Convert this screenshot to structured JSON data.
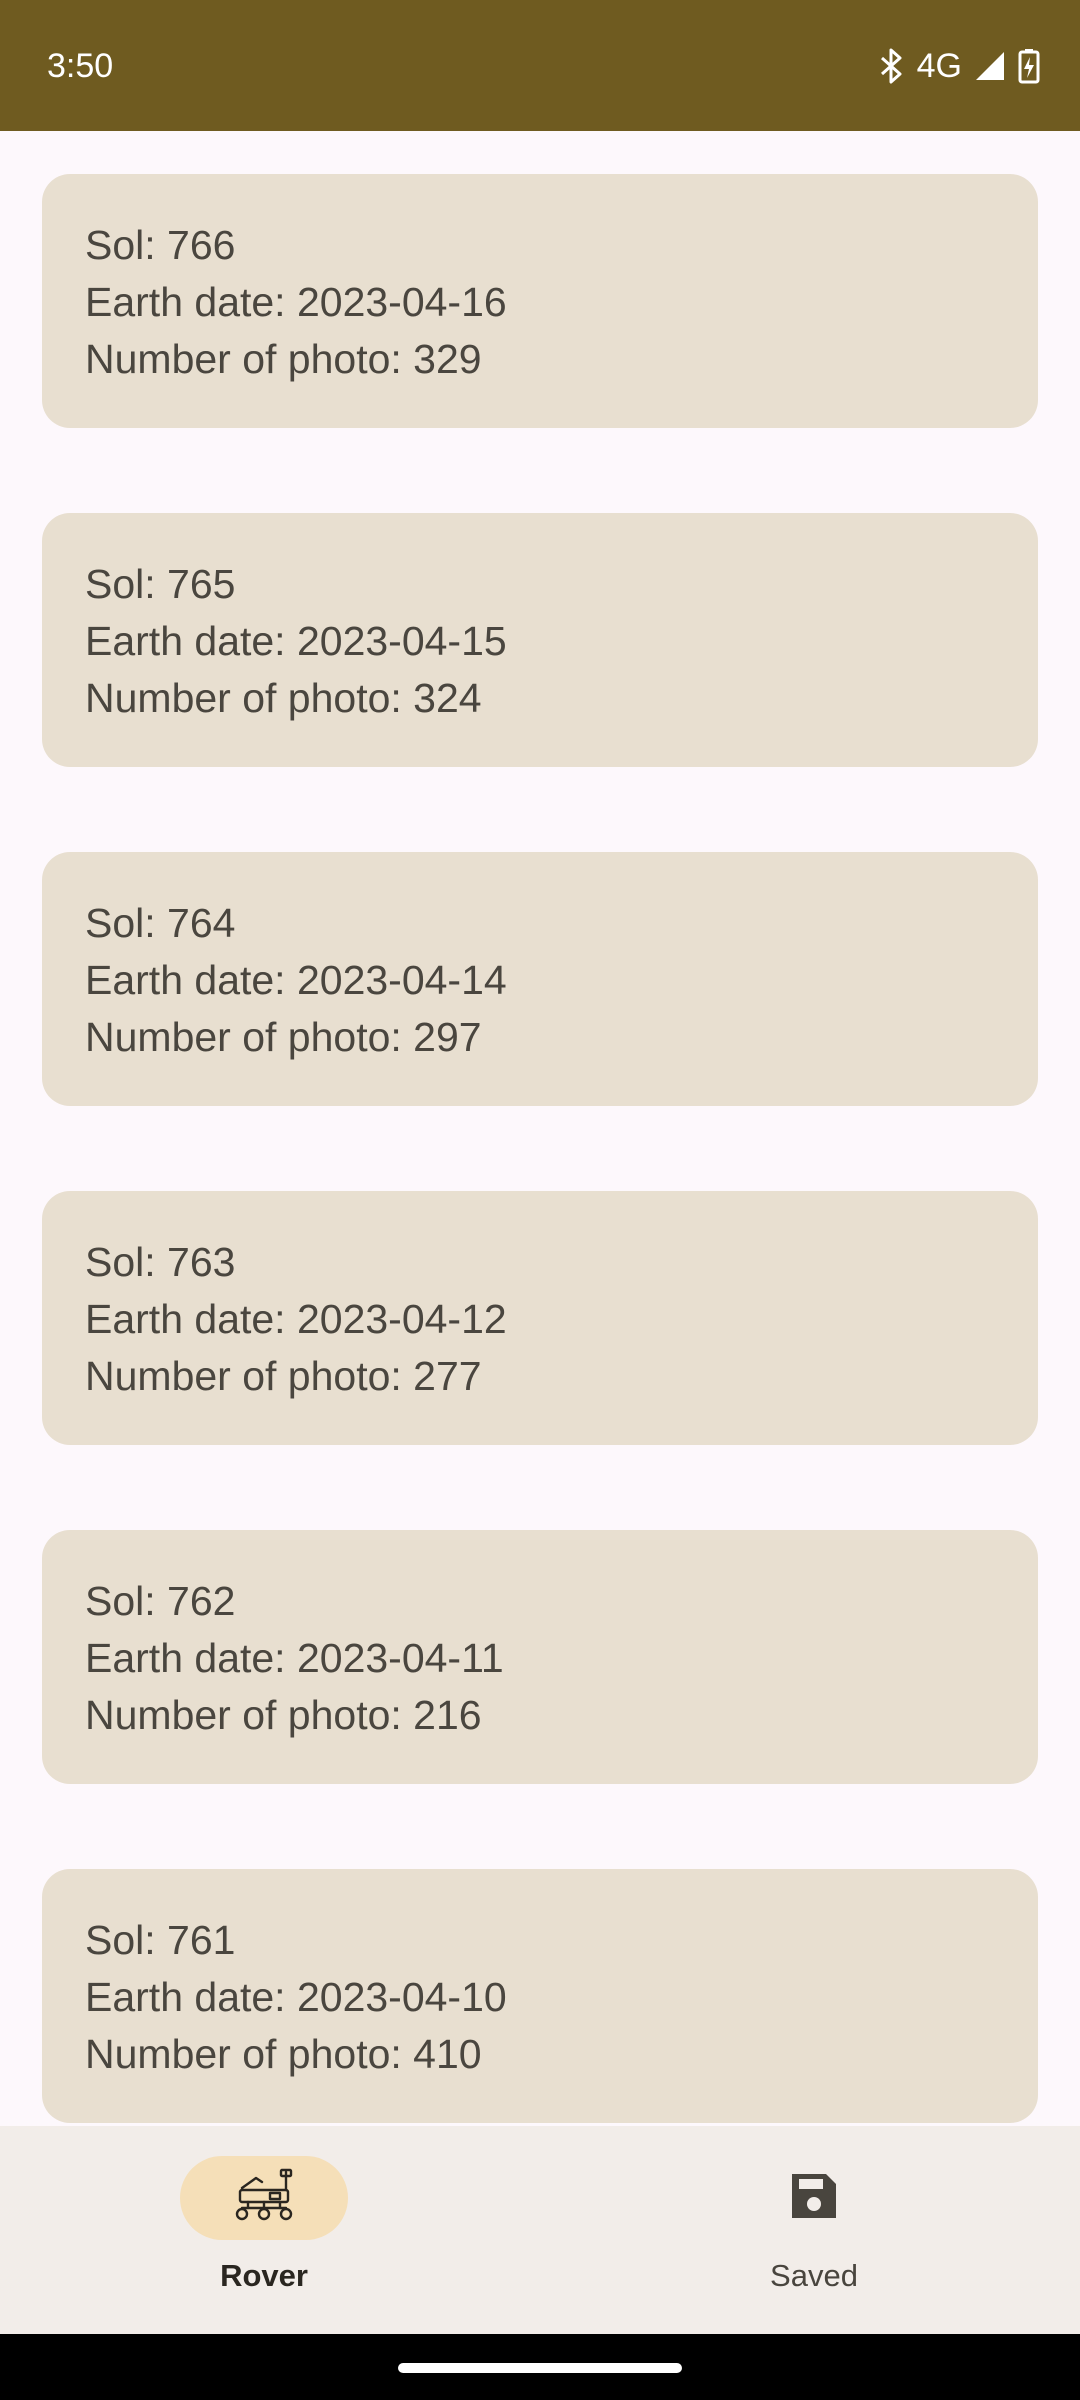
{
  "status_bar": {
    "time": "3:50",
    "network": "4G",
    "icons": [
      "bluetooth-icon",
      "signal-icon",
      "battery-charging-icon"
    ],
    "background": "#6F5B20"
  },
  "sols": [
    {
      "sol": "Sol: 766",
      "earth_date": "Earth date: 2023-04-16",
      "photos": "Number of photo: 329"
    },
    {
      "sol": "Sol: 765",
      "earth_date": "Earth date: 2023-04-15",
      "photos": "Number of photo: 324"
    },
    {
      "sol": "Sol: 764",
      "earth_date": "Earth date: 2023-04-14",
      "photos": "Number of photo: 297"
    },
    {
      "sol": "Sol: 763",
      "earth_date": "Earth date: 2023-04-12",
      "photos": "Number of photo: 277"
    },
    {
      "sol": "Sol: 762",
      "earth_date": "Earth date: 2023-04-11",
      "photos": "Number of photo: 216"
    },
    {
      "sol": "Sol: 761",
      "earth_date": "Earth date: 2023-04-10",
      "photos": "Number of photo: 410"
    }
  ],
  "bottom_nav": {
    "items": [
      {
        "label": "Rover",
        "icon": "rover-icon",
        "selected": true
      },
      {
        "label": "Saved",
        "icon": "save-icon",
        "selected": false
      }
    ],
    "accent": "#F5DFB8"
  },
  "colors": {
    "card_background": "#E8DFD0",
    "page_background": "#FDF8FC"
  }
}
